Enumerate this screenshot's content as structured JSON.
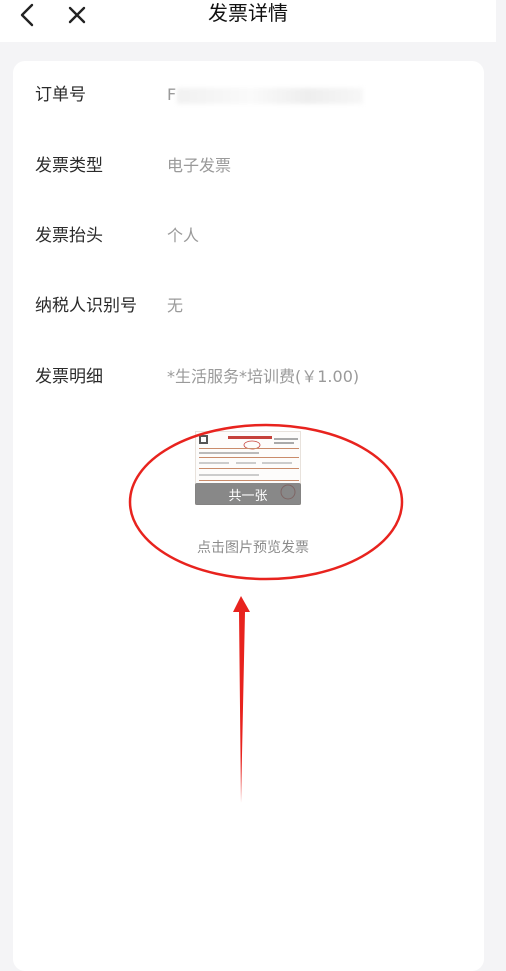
{
  "header": {
    "title": "发票详情"
  },
  "details": [
    {
      "label": "订单号",
      "value": "F"
    },
    {
      "label": "发票类型",
      "value": "电子发票"
    },
    {
      "label": "发票抬头",
      "value": "个人"
    },
    {
      "label": "纳税人识别号",
      "value": "无"
    },
    {
      "label": "发票明细",
      "value": "*生活服务*培训费(￥1.00)"
    }
  ],
  "preview": {
    "count_label": "共一张",
    "hint": "点击图片预览发票"
  },
  "colors": {
    "annotation": "#e8231e",
    "label": "#2b2b2b",
    "value": "#9a9a9a"
  }
}
